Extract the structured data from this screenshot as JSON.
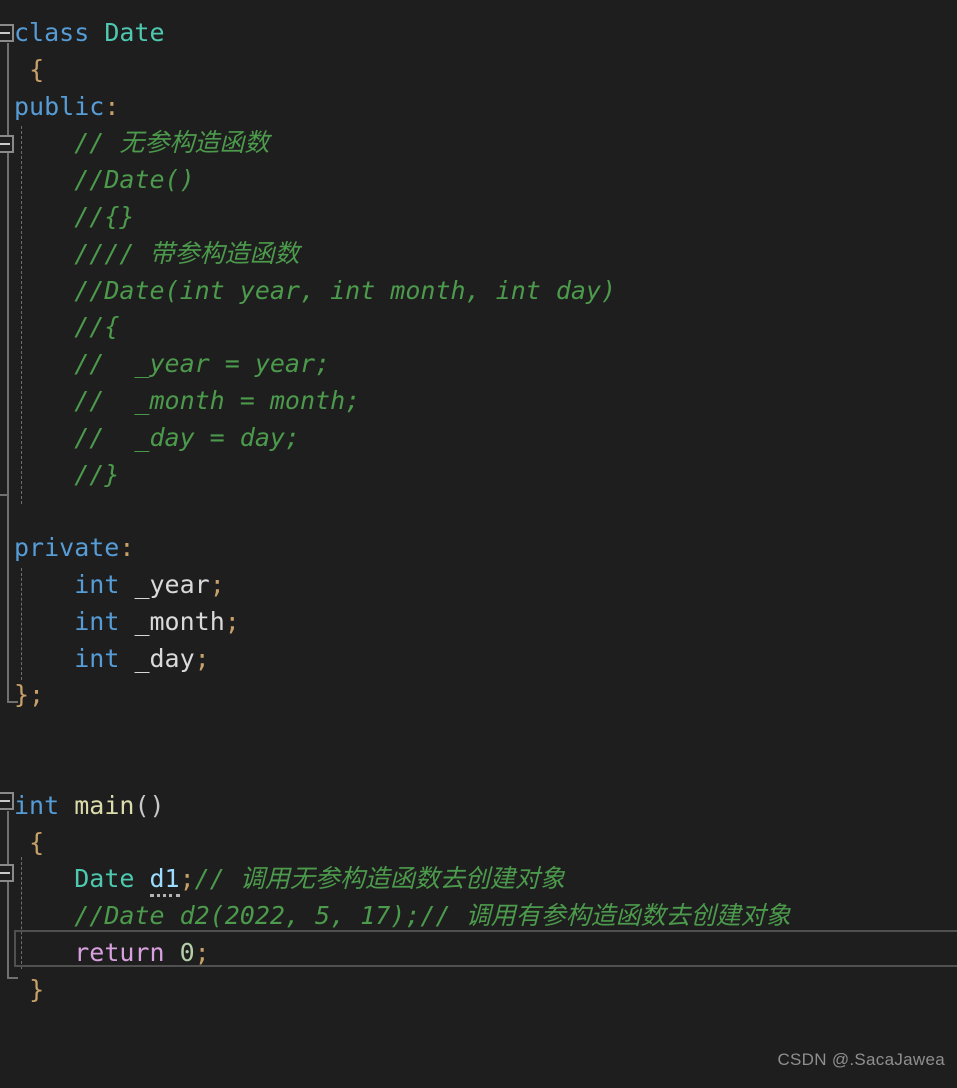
{
  "editor": {
    "language": "cpp",
    "background_color": "#1E1E1E",
    "foreground_color": "#D4D4D4",
    "current_line": 22,
    "colors": {
      "keyword": "#569CD6",
      "type": "#4EC9B0",
      "function": "#DCDCAA",
      "comment": "#4C9A4C",
      "number": "#B5CEA8",
      "return_keyword": "#D8A0DF",
      "punctuation": "#C8A16A",
      "local_variable": "#9CDCFE",
      "plain_identifier": "#DADADA",
      "indent_guide": "#6E6E6E",
      "fold_rail": "#707070",
      "current_line_border": "#505050"
    },
    "lines": [
      {
        "n": 1,
        "text": "class Date"
      },
      {
        "n": 2,
        "text": "{"
      },
      {
        "n": 3,
        "text": "public:"
      },
      {
        "n": 4,
        "text": "    // 无参构造函数"
      },
      {
        "n": 5,
        "text": "    //Date()"
      },
      {
        "n": 6,
        "text": "    //{}"
      },
      {
        "n": 7,
        "text": "    //// 带参构造函数"
      },
      {
        "n": 8,
        "text": "    //Date(int year, int month, int day)"
      },
      {
        "n": 9,
        "text": "    //{"
      },
      {
        "n": 10,
        "text": "    //  _year = year;"
      },
      {
        "n": 11,
        "text": "    //  _month = month;"
      },
      {
        "n": 12,
        "text": "    //  _day = day;"
      },
      {
        "n": 13,
        "text": "    //}"
      },
      {
        "n": 14,
        "text": ""
      },
      {
        "n": 15,
        "text": "private:"
      },
      {
        "n": 16,
        "text": "    int _year;"
      },
      {
        "n": 17,
        "text": "    int _month;"
      },
      {
        "n": 18,
        "text": "    int _day;"
      },
      {
        "n": 19,
        "text": "};"
      },
      {
        "n": 20,
        "text": ""
      },
      {
        "n": 21,
        "text": ""
      },
      {
        "n": 22,
        "text": "int main()"
      },
      {
        "n": 23,
        "text": "{"
      },
      {
        "n": 24,
        "text": "    Date d1;// 调用无参构造函数去创建对象"
      },
      {
        "n": 25,
        "text": "    //Date d2(2022, 5, 17);// 调用有参构造函数去创建对象"
      },
      {
        "n": 26,
        "text": "    return 0;"
      },
      {
        "n": 27,
        "text": "}"
      }
    ],
    "tokens": {
      "kw_class": "class",
      "type_date": "Date",
      "brace_open": "{",
      "brace_close": "}",
      "kw_public": "public",
      "kw_private": "private",
      "colon": ":",
      "semicolon": ";",
      "kw_int": "int",
      "fn_main": "main",
      "parens_empty": "()",
      "var_year": "_year",
      "var_month": "_month",
      "var_day": "_day",
      "var_d1": "d1",
      "kw_return": "return",
      "num_zero": "0",
      "brace_close_semi": "};"
    },
    "comments": {
      "c1": "// 无参构造函数",
      "c1_ascii": "// ",
      "c1_han": "无参构造函数",
      "c2": "//Date()",
      "c3": "//{}",
      "c4_ascii": "//// ",
      "c4_han": "带参构造函数",
      "c5": "//Date(int year, int month, int day)",
      "c6": "//{",
      "c7": "//  _year = year;",
      "c8": "//  _month = month;",
      "c9": "//  _day = day;",
      "c10": "//}",
      "c11_ascii": "// ",
      "c11_han": "调用无参构造函数去创建对象",
      "c12_ascii": "//Date d2(2022, 5, 17);// ",
      "c12_han": "调用有参构造函数去创建对象"
    },
    "fold_markers": [
      {
        "name": "fold-class-date",
        "line": 1,
        "state": "expanded",
        "glyph": "-"
      },
      {
        "name": "fold-public-block",
        "line": 4,
        "state": "expanded",
        "glyph": "-"
      },
      {
        "name": "fold-main-function",
        "line": 22,
        "state": "expanded",
        "glyph": "-"
      },
      {
        "name": "fold-main-body",
        "line": 24,
        "state": "expanded",
        "glyph": "-"
      }
    ]
  },
  "watermark": {
    "text": "CSDN @.SacaJawea"
  }
}
